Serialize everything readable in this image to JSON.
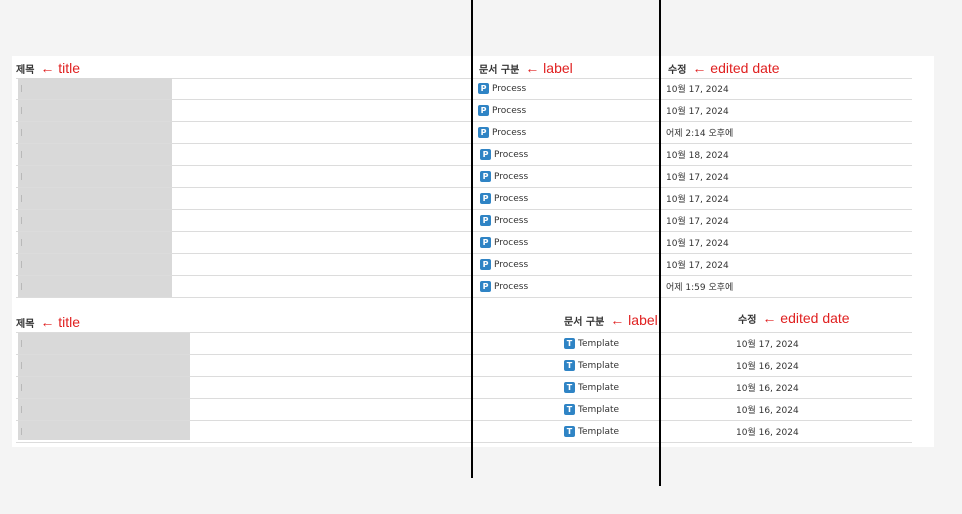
{
  "section1": {
    "title_header": "제목",
    "title_annotation": "← title",
    "label_header": "문서 구분",
    "label_annotation": "← label",
    "edited_header": "수정",
    "edited_annotation": "← edited date",
    "rows": [
      {
        "badge": "P",
        "label": "Process",
        "edited": "10월 17, 2024"
      },
      {
        "badge": "P",
        "label": "Process",
        "edited": "10월 17, 2024"
      },
      {
        "badge": "P",
        "label": "Process",
        "edited": "어제 2:14 오후에"
      },
      {
        "badge": "P",
        "label": "Process",
        "edited": "10월 18, 2024"
      },
      {
        "badge": "P",
        "label": "Process",
        "edited": "10월 17, 2024"
      },
      {
        "badge": "P",
        "label": "Process",
        "edited": "10월 17, 2024"
      },
      {
        "badge": "P",
        "label": "Process",
        "edited": "10월 17, 2024"
      },
      {
        "badge": "P",
        "label": "Process",
        "edited": "10월 17, 2024"
      },
      {
        "badge": "P",
        "label": "Process",
        "edited": "10월 17, 2024"
      },
      {
        "badge": "P",
        "label": "Process",
        "edited": "어제 1:59 오후에"
      }
    ]
  },
  "section2": {
    "title_header": "제목",
    "title_annotation": "← title",
    "label_header": "문서 구분",
    "label_annotation": "← label",
    "edited_header": "수정",
    "edited_annotation": "← edited date",
    "rows": [
      {
        "badge": "T",
        "label": "Template",
        "edited": "10월 17, 2024"
      },
      {
        "badge": "T",
        "label": "Template",
        "edited": "10월 16, 2024"
      },
      {
        "badge": "T",
        "label": "Template",
        "edited": "10월 16, 2024"
      },
      {
        "badge": "T",
        "label": "Template",
        "edited": "10월 16, 2024"
      },
      {
        "badge": "T",
        "label": "Template",
        "edited": "10월 16, 2024"
      }
    ]
  },
  "colors": {
    "badge_blue": "#2f84c5",
    "annotation_red": "#e02020",
    "divider_line": "#000000",
    "redacted_block": "#d9d9d9"
  }
}
